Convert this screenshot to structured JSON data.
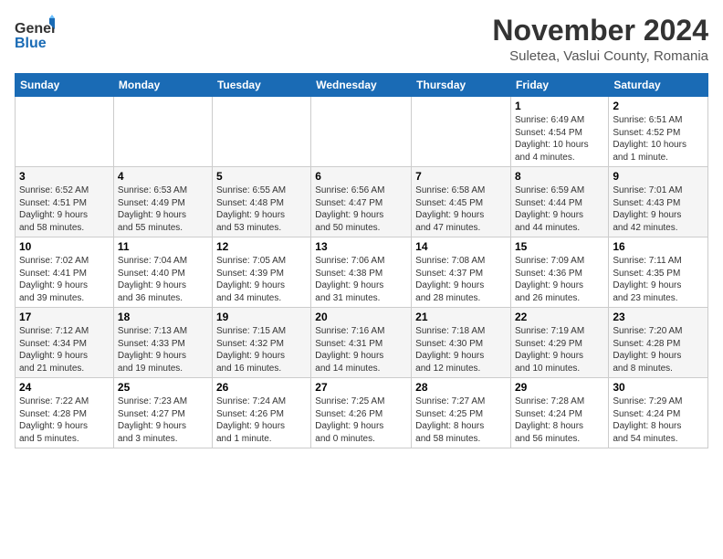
{
  "header": {
    "logo_line1": "General",
    "logo_line2": "Blue",
    "month_title": "November 2024",
    "subtitle": "Suletea, Vaslui County, Romania"
  },
  "weekdays": [
    "Sunday",
    "Monday",
    "Tuesday",
    "Wednesday",
    "Thursday",
    "Friday",
    "Saturday"
  ],
  "weeks": [
    [
      {
        "day": "",
        "info": ""
      },
      {
        "day": "",
        "info": ""
      },
      {
        "day": "",
        "info": ""
      },
      {
        "day": "",
        "info": ""
      },
      {
        "day": "",
        "info": ""
      },
      {
        "day": "1",
        "info": "Sunrise: 6:49 AM\nSunset: 4:54 PM\nDaylight: 10 hours\nand 4 minutes."
      },
      {
        "day": "2",
        "info": "Sunrise: 6:51 AM\nSunset: 4:52 PM\nDaylight: 10 hours\nand 1 minute."
      }
    ],
    [
      {
        "day": "3",
        "info": "Sunrise: 6:52 AM\nSunset: 4:51 PM\nDaylight: 9 hours\nand 58 minutes."
      },
      {
        "day": "4",
        "info": "Sunrise: 6:53 AM\nSunset: 4:49 PM\nDaylight: 9 hours\nand 55 minutes."
      },
      {
        "day": "5",
        "info": "Sunrise: 6:55 AM\nSunset: 4:48 PM\nDaylight: 9 hours\nand 53 minutes."
      },
      {
        "day": "6",
        "info": "Sunrise: 6:56 AM\nSunset: 4:47 PM\nDaylight: 9 hours\nand 50 minutes."
      },
      {
        "day": "7",
        "info": "Sunrise: 6:58 AM\nSunset: 4:45 PM\nDaylight: 9 hours\nand 47 minutes."
      },
      {
        "day": "8",
        "info": "Sunrise: 6:59 AM\nSunset: 4:44 PM\nDaylight: 9 hours\nand 44 minutes."
      },
      {
        "day": "9",
        "info": "Sunrise: 7:01 AM\nSunset: 4:43 PM\nDaylight: 9 hours\nand 42 minutes."
      }
    ],
    [
      {
        "day": "10",
        "info": "Sunrise: 7:02 AM\nSunset: 4:41 PM\nDaylight: 9 hours\nand 39 minutes."
      },
      {
        "day": "11",
        "info": "Sunrise: 7:04 AM\nSunset: 4:40 PM\nDaylight: 9 hours\nand 36 minutes."
      },
      {
        "day": "12",
        "info": "Sunrise: 7:05 AM\nSunset: 4:39 PM\nDaylight: 9 hours\nand 34 minutes."
      },
      {
        "day": "13",
        "info": "Sunrise: 7:06 AM\nSunset: 4:38 PM\nDaylight: 9 hours\nand 31 minutes."
      },
      {
        "day": "14",
        "info": "Sunrise: 7:08 AM\nSunset: 4:37 PM\nDaylight: 9 hours\nand 28 minutes."
      },
      {
        "day": "15",
        "info": "Sunrise: 7:09 AM\nSunset: 4:36 PM\nDaylight: 9 hours\nand 26 minutes."
      },
      {
        "day": "16",
        "info": "Sunrise: 7:11 AM\nSunset: 4:35 PM\nDaylight: 9 hours\nand 23 minutes."
      }
    ],
    [
      {
        "day": "17",
        "info": "Sunrise: 7:12 AM\nSunset: 4:34 PM\nDaylight: 9 hours\nand 21 minutes."
      },
      {
        "day": "18",
        "info": "Sunrise: 7:13 AM\nSunset: 4:33 PM\nDaylight: 9 hours\nand 19 minutes."
      },
      {
        "day": "19",
        "info": "Sunrise: 7:15 AM\nSunset: 4:32 PM\nDaylight: 9 hours\nand 16 minutes."
      },
      {
        "day": "20",
        "info": "Sunrise: 7:16 AM\nSunset: 4:31 PM\nDaylight: 9 hours\nand 14 minutes."
      },
      {
        "day": "21",
        "info": "Sunrise: 7:18 AM\nSunset: 4:30 PM\nDaylight: 9 hours\nand 12 minutes."
      },
      {
        "day": "22",
        "info": "Sunrise: 7:19 AM\nSunset: 4:29 PM\nDaylight: 9 hours\nand 10 minutes."
      },
      {
        "day": "23",
        "info": "Sunrise: 7:20 AM\nSunset: 4:28 PM\nDaylight: 9 hours\nand 8 minutes."
      }
    ],
    [
      {
        "day": "24",
        "info": "Sunrise: 7:22 AM\nSunset: 4:28 PM\nDaylight: 9 hours\nand 5 minutes."
      },
      {
        "day": "25",
        "info": "Sunrise: 7:23 AM\nSunset: 4:27 PM\nDaylight: 9 hours\nand 3 minutes."
      },
      {
        "day": "26",
        "info": "Sunrise: 7:24 AM\nSunset: 4:26 PM\nDaylight: 9 hours\nand 1 minute."
      },
      {
        "day": "27",
        "info": "Sunrise: 7:25 AM\nSunset: 4:26 PM\nDaylight: 9 hours\nand 0 minutes."
      },
      {
        "day": "28",
        "info": "Sunrise: 7:27 AM\nSunset: 4:25 PM\nDaylight: 8 hours\nand 58 minutes."
      },
      {
        "day": "29",
        "info": "Sunrise: 7:28 AM\nSunset: 4:24 PM\nDaylight: 8 hours\nand 56 minutes."
      },
      {
        "day": "30",
        "info": "Sunrise: 7:29 AM\nSunset: 4:24 PM\nDaylight: 8 hours\nand 54 minutes."
      }
    ]
  ]
}
